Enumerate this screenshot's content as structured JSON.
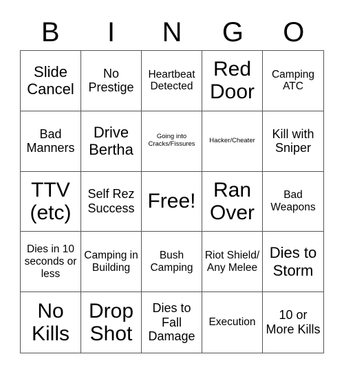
{
  "header": {
    "letters": [
      "B",
      "I",
      "N",
      "G",
      "O"
    ]
  },
  "cells": [
    {
      "text": "Slide Cancel",
      "size": "l"
    },
    {
      "text": "No Prestige",
      "size": "m"
    },
    {
      "text": "Heartbeat Detected",
      "size": "s"
    },
    {
      "text": "Red Door",
      "size": "xl"
    },
    {
      "text": "Camping ATC",
      "size": "s"
    },
    {
      "text": "Bad Manners",
      "size": "m"
    },
    {
      "text": "Drive Bertha",
      "size": "l"
    },
    {
      "text": "Going into Cracks/Fissures",
      "size": "xs"
    },
    {
      "text": "Hacker/Cheater",
      "size": "xs"
    },
    {
      "text": "Kill with Sniper",
      "size": "m"
    },
    {
      "text": "TTV (etc)",
      "size": "xl"
    },
    {
      "text": "Self Rez Success",
      "size": "m"
    },
    {
      "text": "Free!",
      "size": "xl"
    },
    {
      "text": "Ran Over",
      "size": "xl"
    },
    {
      "text": "Bad Weapons",
      "size": "s"
    },
    {
      "text": "Dies in 10 seconds or less",
      "size": "s"
    },
    {
      "text": "Camping in Building",
      "size": "s"
    },
    {
      "text": "Bush Camping",
      "size": "s"
    },
    {
      "text": "Riot Shield/ Any Melee",
      "size": "s"
    },
    {
      "text": "Dies to Storm",
      "size": "l"
    },
    {
      "text": "No Kills",
      "size": "xl"
    },
    {
      "text": "Drop Shot",
      "size": "xl"
    },
    {
      "text": "Dies to Fall Damage",
      "size": "m"
    },
    {
      "text": "Execution",
      "size": "s"
    },
    {
      "text": "10 or More Kills",
      "size": "m"
    }
  ]
}
